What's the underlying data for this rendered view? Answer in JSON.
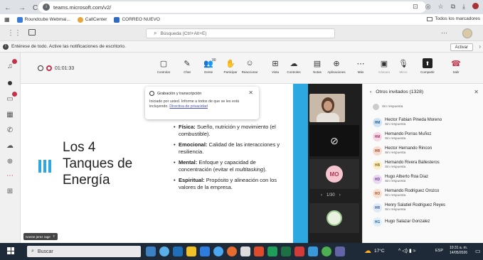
{
  "browser": {
    "url": "teams.microsoft.com/v2/",
    "nav": [
      "←",
      "→",
      "C"
    ],
    "right_icons": [
      "⊡",
      "◎",
      "☆",
      "⧉",
      "⤓"
    ]
  },
  "bookmarks": [
    {
      "label": "Roundcube Webmai...",
      "color": "#3a7bd5"
    },
    {
      "label": "CallCenter",
      "color": "#e8a33d"
    },
    {
      "label": "CORREO NUEVO",
      "color": "#2f6bbf"
    }
  ],
  "bookmarks_all": "Todos los marcadores",
  "teams": {
    "search_placeholder": "Búsqueda (Ctrl+Alt+E)"
  },
  "notice": {
    "text": "Entérese de todo. Active las notificaciones de escritorio.",
    "button": "Activar"
  },
  "meeting": {
    "timer": "01:01:33",
    "toolbar": [
      {
        "icon": "share-screen",
        "glyph": "▢",
        "label": "Controlar"
      },
      {
        "icon": "chat",
        "glyph": "✎",
        "label": "Chat"
      },
      {
        "icon": "people",
        "glyph": "👥",
        "label": "Gente",
        "count": "90"
      },
      {
        "icon": "raise-hand",
        "glyph": "✋",
        "label": "Participar"
      },
      {
        "icon": "react",
        "glyph": "☺",
        "label": "Reaccionar"
      },
      {
        "icon": "view",
        "glyph": "⊞",
        "label": "Vista"
      },
      {
        "icon": "controls",
        "glyph": "☁",
        "label": "Controles"
      },
      {
        "icon": "notes",
        "glyph": "▤",
        "label": "Notas"
      },
      {
        "icon": "apps",
        "glyph": "⊕",
        "label": "Aplicaciones"
      },
      {
        "icon": "more",
        "glyph": "⋯",
        "label": "Más"
      },
      {
        "icon": "camera",
        "glyph": "▣",
        "label": "Cámara",
        "dim": true
      },
      {
        "icon": "mic",
        "glyph": "🎙",
        "label": "Micro",
        "dim": true
      },
      {
        "icon": "share",
        "glyph": "⬆",
        "label": "Compartir"
      },
      {
        "icon": "leave",
        "glyph": "☎",
        "label": "Salir"
      }
    ]
  },
  "recording_popup": {
    "title": "Grabación y transcripción",
    "body": "Iniciado por usted. Informe a todos de que se les está incluyendo.",
    "link": "Directiva de privacidad"
  },
  "slide": {
    "title_lines": [
      "Los 4",
      "Tanques de",
      "Energía"
    ],
    "bullets": [
      {
        "bold": "Física:",
        "text": " Sueño, nutrición y movimiento (el combustible)."
      },
      {
        "bold": "Emocional:",
        "text": " Calidad de las interacciones y resiliencia."
      },
      {
        "bold": "Mental:",
        "text": " Enfoque y capacidad de concentración (evitar el ",
        "italic": "multitasking",
        "after": ")."
      },
      {
        "bold": "Espiritual:",
        "text": " Propósito y alineación con los valores de la empresa."
      }
    ],
    "presenter_tag": "Ivonne jerez rage",
    "accent": "#2ea8e0"
  },
  "participants_strip": {
    "initials": "MO",
    "pager": "1/30"
  },
  "panel": {
    "title": "Otros invitados (1328)",
    "items": [
      {
        "initials": "",
        "name": "Sin respuesta",
        "status": "",
        "color": "#ccc"
      },
      {
        "initials": "HM",
        "name": "Hector Fabian Pineda Moreno",
        "status": "Sin respuesta",
        "color": "#cfe3f5",
        "fg": "#2c5d8a"
      },
      {
        "initials": "HM",
        "name": "Hernando Porras Muñoz",
        "status": "Sin respuesta",
        "color": "#f7d7e6",
        "fg": "#a13a6b"
      },
      {
        "initials": "HR",
        "name": "Hector Hernando Rincon",
        "status": "Sin respuesta",
        "color": "#f6dcd0",
        "fg": "#9a4a28"
      },
      {
        "initials": "HB",
        "name": "Hernando Rivera Ballesteros",
        "status": "Sin respuesta",
        "color": "#fbeec8",
        "fg": "#8a6a10"
      },
      {
        "initials": "HD",
        "name": "Hugo Alberto Roa Diaz",
        "status": "Sin respuesta",
        "color": "#ead7f2",
        "fg": "#6e3a85"
      },
      {
        "initials": "HO",
        "name": "Hernando Rodriguez Orozco",
        "status": "Sin respuesta",
        "color": "#f9dfd0",
        "fg": "#a1542a"
      },
      {
        "initials": "HR",
        "name": "Henry Salatiel Rodriguez Reyes",
        "status": "Sin respuesta",
        "color": "#dfe9f7",
        "fg": "#3b5b8a"
      },
      {
        "initials": "HG",
        "name": "Hugo Salazar Gonzalez",
        "status": "",
        "color": "#dfeefa",
        "fg": "#2f6a93"
      }
    ]
  },
  "taskbar": {
    "search": "Buscar",
    "temp": "17°C",
    "lang": "ESP",
    "time": "10:31 a. m.",
    "date": "14/05/2026"
  }
}
